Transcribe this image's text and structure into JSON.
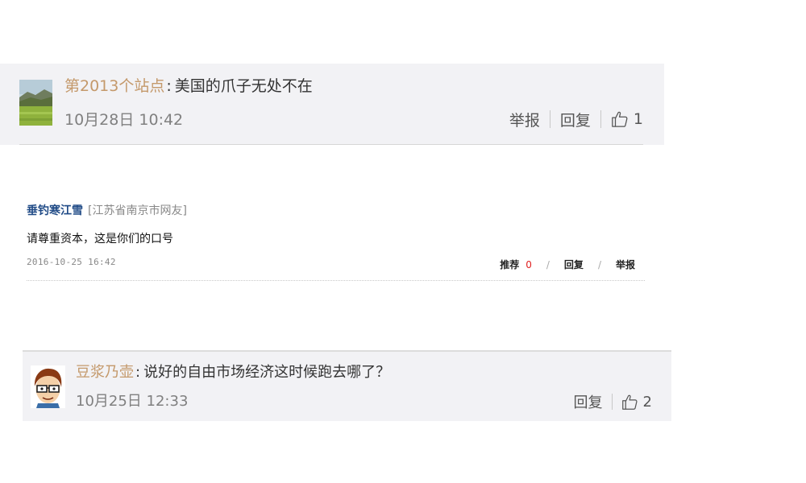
{
  "comments": [
    {
      "user": "第2013个站点",
      "separator": ":",
      "text": "美国的爪子无处不在",
      "time": "10月28日 10:42",
      "report_label": "举报",
      "reply_label": "回复",
      "like_count": "1",
      "avatar_icon": "landscape-avatar-icon"
    },
    {
      "user": "垂钓寒江雪",
      "location": "[江苏省南京市网友]",
      "text": "请尊重资本，这是你们的口号",
      "time": "2016-10-25 16:42",
      "recommend_label": "推荐",
      "recommend_count": "0",
      "slash1": "/",
      "reply_label": "回复",
      "slash2": "/",
      "report_label": "举报"
    },
    {
      "user": "豆浆乃壶",
      "separator": ":",
      "text": "说好的自由市场经济这时候跑去哪了？",
      "time": "10月25日 12:33",
      "reply_label": "回复",
      "like_count": "2",
      "avatar_icon": "cartoon-face-avatar-icon"
    }
  ],
  "colors": {
    "weibo_username": "#c4996b",
    "news_username": "#1f4a86",
    "card_background": "#f2f2f5",
    "recommend_count": "#e02020"
  }
}
